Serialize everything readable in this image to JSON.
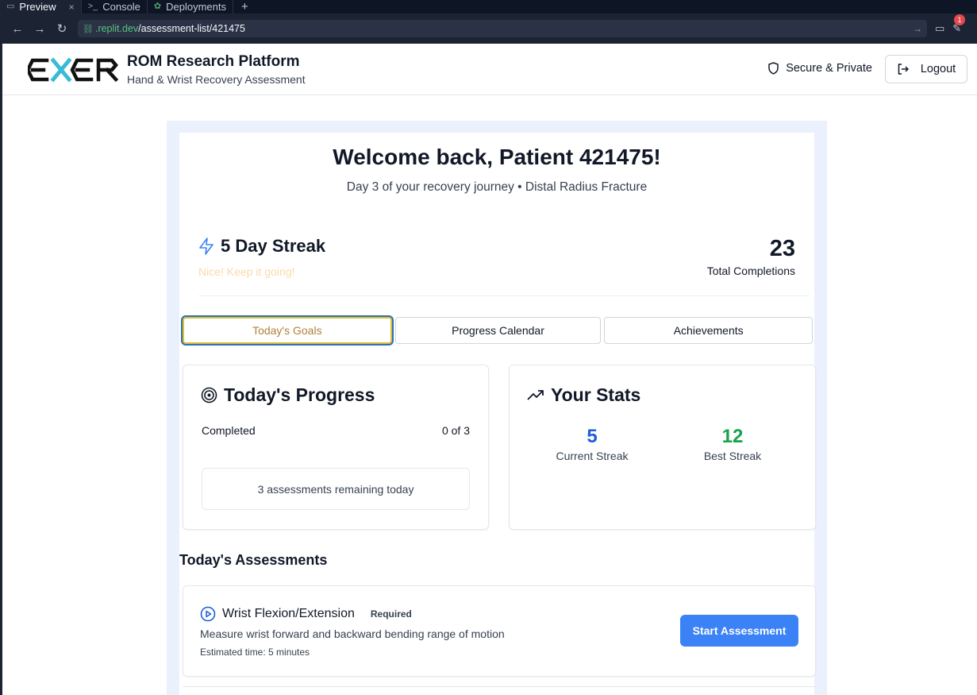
{
  "ide": {
    "tabs": [
      {
        "label": "Preview",
        "icon": "monitor-icon"
      },
      {
        "label": "Console",
        "icon": "terminal-icon"
      },
      {
        "label": "Deployments",
        "icon": "deploy-icon"
      }
    ],
    "url_host": ".replit.dev",
    "url_path": "/assessment-list/421475",
    "notification_count": "1"
  },
  "header": {
    "logo_alt": "EXER",
    "title": "ROM Research Platform",
    "subtitle": "Hand & Wrist Recovery Assessment",
    "secure_label": "Secure & Private",
    "logout_label": "Logout"
  },
  "welcome": {
    "title": "Welcome back, Patient 421475!",
    "subtitle": "Day 3 of your recovery journey • Distal Radius Fracture"
  },
  "streak": {
    "title": "5 Day Streak",
    "message": "Nice! Keep it going!",
    "total_value": "23",
    "total_label": "Total Completions"
  },
  "tabs": {
    "goals": "Today's Goals",
    "calendar": "Progress Calendar",
    "achievements": "Achievements"
  },
  "progress": {
    "title": "Today's Progress",
    "completed_label": "Completed",
    "completed_value": "0 of 3",
    "remaining": "3 assessments remaining today"
  },
  "stats": {
    "title": "Your Stats",
    "current_value": "5",
    "current_label": "Current Streak",
    "best_value": "12",
    "best_label": "Best Streak",
    "colors": {
      "current": "#1d5fd6",
      "best": "#16a34a"
    }
  },
  "assessments": {
    "section_title": "Today's Assessments",
    "items": [
      {
        "title": "Wrist Flexion/Extension",
        "badge": "Required",
        "description": "Measure wrist forward and backward bending range of motion",
        "time": "Estimated time: 5 minutes",
        "action": "Start Assessment"
      }
    ]
  },
  "colors": {
    "accent": "#3b82f6",
    "page_bg": "#eaf1fc"
  }
}
